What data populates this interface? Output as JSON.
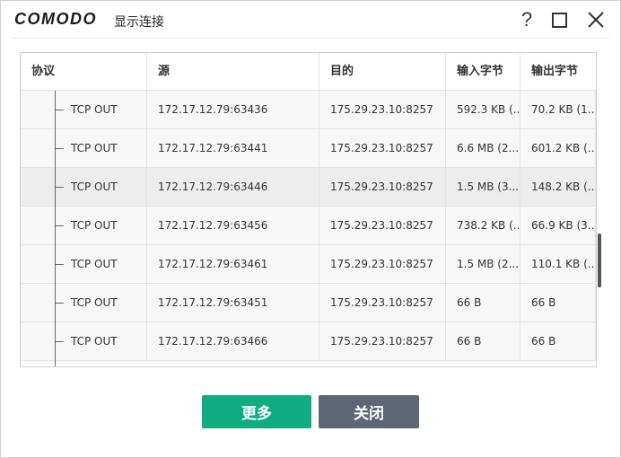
{
  "window": {
    "logo": "COMODO",
    "title": "显示连接",
    "help_label": "?"
  },
  "table": {
    "headers": {
      "protocol": "协议",
      "source": "源",
      "destination": "目的",
      "bytes_in": "输入字节",
      "bytes_out": "输出字节"
    },
    "rows": [
      {
        "protocol": "TCP OUT",
        "source": "172.17.12.79:63436",
        "destination": "175.29.23.10:8257",
        "bytes_in": "592.3 KB (...",
        "bytes_out": "70.2 KB (1...",
        "selected": false
      },
      {
        "protocol": "TCP OUT",
        "source": "172.17.12.79:63441",
        "destination": "175.29.23.10:8257",
        "bytes_in": "6.6 MB (2....",
        "bytes_out": "601.2 KB (...",
        "selected": false
      },
      {
        "protocol": "TCP OUT",
        "source": "172.17.12.79:63446",
        "destination": "175.29.23.10:8257",
        "bytes_in": "1.5 MB (3....",
        "bytes_out": "148.2 KB (...",
        "selected": true
      },
      {
        "protocol": "TCP OUT",
        "source": "172.17.12.79:63456",
        "destination": "175.29.23.10:8257",
        "bytes_in": "738.2 KB (...",
        "bytes_out": "66.9 KB (3....",
        "selected": false
      },
      {
        "protocol": "TCP OUT",
        "source": "172.17.12.79:63461",
        "destination": "175.29.23.10:8257",
        "bytes_in": "1.5 MB (2....",
        "bytes_out": "110.1 KB (...",
        "selected": false
      },
      {
        "protocol": "TCP OUT",
        "source": "172.17.12.79:63451",
        "destination": "175.29.23.10:8257",
        "bytes_in": "66 B",
        "bytes_out": "66 B",
        "selected": false
      },
      {
        "protocol": "TCP OUT",
        "source": "172.17.12.79:63466",
        "destination": "175.29.23.10:8257",
        "bytes_in": "66 B",
        "bytes_out": "66 B",
        "selected": false
      }
    ]
  },
  "buttons": {
    "more": "更多",
    "close": "关闭"
  },
  "colors": {
    "more_button": "#10ad82",
    "close_button": "#5c6674",
    "selected_row": "#ededed",
    "row_background": "#f7f7f7"
  },
  "icons": {
    "help": "help-icon",
    "maximize": "maximize-icon",
    "close": "close-icon"
  }
}
